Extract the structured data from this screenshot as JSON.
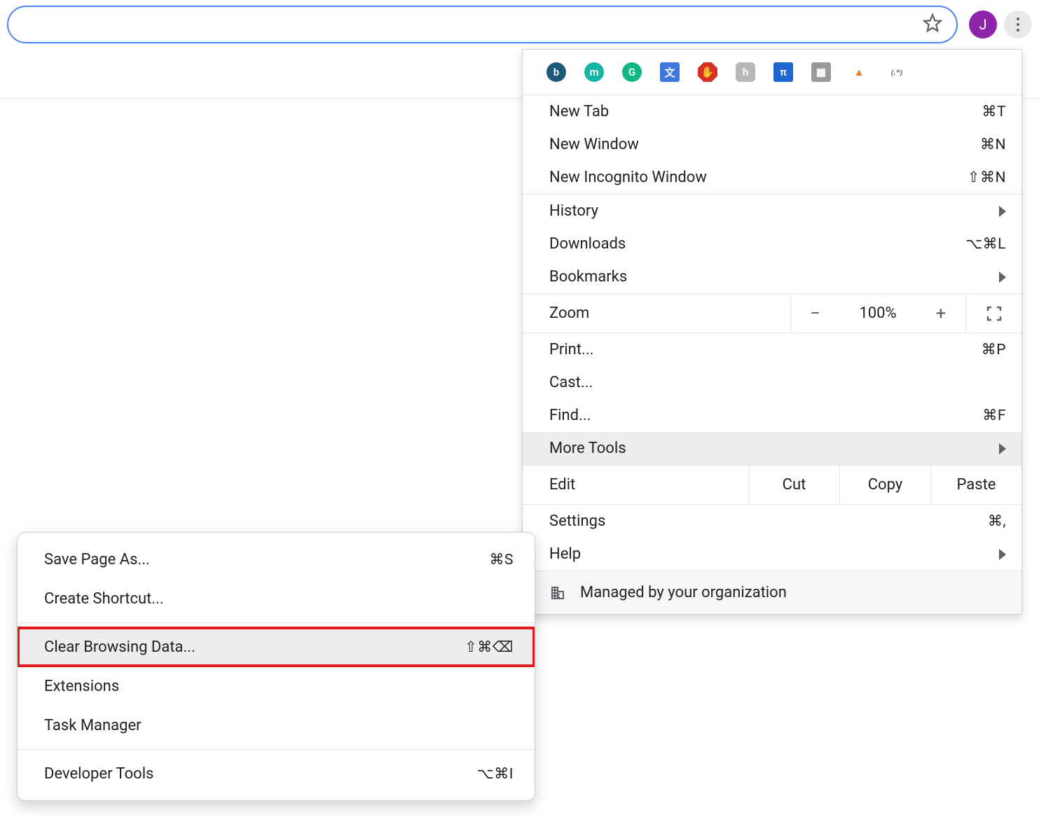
{
  "toolbar": {
    "avatar_initial": "J"
  },
  "extensions": [
    {
      "name": "ext-b",
      "letter": "b",
      "bg": "#1d5a7a",
      "fg": "#fff",
      "shape": "circle"
    },
    {
      "name": "ext-m",
      "letter": "m",
      "bg": "#17b3a3",
      "fg": "#fff",
      "shape": "circle"
    },
    {
      "name": "ext-grammarly",
      "letter": "G",
      "bg": "#0fb883",
      "fg": "#fff",
      "shape": "circle"
    },
    {
      "name": "ext-translate",
      "letter": "文",
      "bg": "#3f77e0",
      "fg": "#fff",
      "shape": "square"
    },
    {
      "name": "ext-adblock",
      "letter": "✋",
      "bg": "#d93025",
      "fg": "#fff",
      "shape": "octagon"
    },
    {
      "name": "ext-honey",
      "letter": "h",
      "bg": "#b8b8b8",
      "fg": "#fff",
      "shape": "rounded"
    },
    {
      "name": "ext-tt",
      "letter": "π",
      "bg": "#1e66d0",
      "fg": "#fff",
      "shape": "square"
    },
    {
      "name": "ext-code",
      "letter": "▦",
      "bg": "#9a9a9a",
      "fg": "#fff",
      "shape": "square"
    },
    {
      "name": "ext-pyramid",
      "letter": "▲",
      "bg": "#fff",
      "fg": "#e67e22",
      "shape": "none"
    },
    {
      "name": "ext-regex",
      "letter": "(.*)",
      "bg": "#fff",
      "fg": "#6b6b6b",
      "shape": "none"
    }
  ],
  "menu": {
    "new_tab": {
      "label": "New Tab",
      "shortcut": "⌘T"
    },
    "new_window": {
      "label": "New Window",
      "shortcut": "⌘N"
    },
    "new_incognito": {
      "label": "New Incognito Window",
      "shortcut": "⇧⌘N"
    },
    "history": {
      "label": "History"
    },
    "downloads": {
      "label": "Downloads",
      "shortcut": "⌥⌘L"
    },
    "bookmarks": {
      "label": "Bookmarks"
    },
    "zoom": {
      "label": "Zoom",
      "value": "100%",
      "minus": "−",
      "plus": "+"
    },
    "print": {
      "label": "Print...",
      "shortcut": "⌘P"
    },
    "cast": {
      "label": "Cast..."
    },
    "find": {
      "label": "Find...",
      "shortcut": "⌘F"
    },
    "more_tools": {
      "label": "More Tools"
    },
    "edit": {
      "label": "Edit",
      "cut": "Cut",
      "copy": "Copy",
      "paste": "Paste"
    },
    "settings": {
      "label": "Settings",
      "shortcut": "⌘,"
    },
    "help": {
      "label": "Help"
    },
    "managed": {
      "label": "Managed by your organization"
    }
  },
  "submenu": {
    "save_page_as": {
      "label": "Save Page As...",
      "shortcut": "⌘S"
    },
    "create_shortcut": {
      "label": "Create Shortcut..."
    },
    "clear_browsing_data": {
      "label": "Clear Browsing Data...",
      "shortcut": "⇧⌘⌫"
    },
    "extensions": {
      "label": "Extensions"
    },
    "task_manager": {
      "label": "Task Manager"
    },
    "developer_tools": {
      "label": "Developer Tools",
      "shortcut": "⌥⌘I"
    }
  }
}
